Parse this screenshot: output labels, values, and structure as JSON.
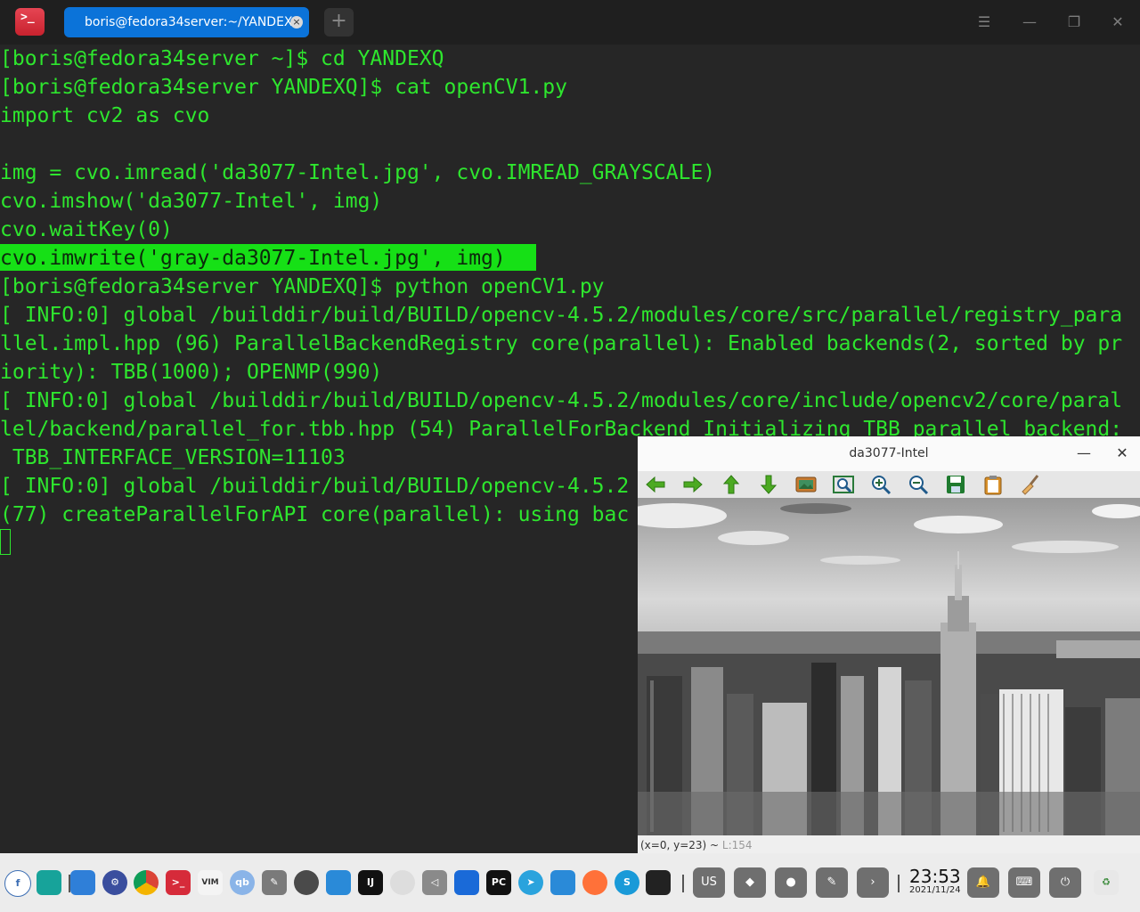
{
  "window": {
    "tab_title": "boris@fedora34server:~/YANDEXQ",
    "tab_close": "×",
    "tab_add": "+",
    "menu_glyph": "☰",
    "minimize_glyph": "—",
    "restore_glyph": "❐",
    "close_glyph": "✕"
  },
  "terminal": {
    "highlight_color": "#16e016",
    "text_color": "#2ee62e",
    "lines": [
      "[boris@fedora34server ~]$ cd YANDEXQ",
      "[boris@fedora34server YANDEXQ]$ cat openCV1.py",
      "import cv2 as cvo",
      "",
      "img = cvo.imread('da3077-Intel.jpg', cvo.IMREAD_GRAYSCALE)",
      "cvo.imshow('da3077-Intel', img)",
      "cvo.waitKey(0)",
      "cvo.imwrite('gray-da3077-Intel.jpg', img)",
      "[boris@fedora34server YANDEXQ]$ python openCV1.py",
      "[ INFO:0] global /builddir/build/BUILD/opencv-4.5.2/modules/core/src/parallel/registry_para",
      "llel.impl.hpp (96) ParallelBackendRegistry core(parallel): Enabled backends(2, sorted by pr",
      "iority): TBB(1000); OPENMP(990)",
      "[ INFO:0] global /builddir/build/BUILD/opencv-4.5.2/modules/core/include/opencv2/core/paral",
      "lel/backend/parallel_for.tbb.hpp (54) ParallelForBackend Initializing TBB parallel backend:",
      " TBB_INTERFACE_VERSION=11103",
      "[ INFO:0] global /builddir/build/BUILD/opencv-4.5.2",
      "(77) createParallelForAPI core(parallel): using bac"
    ]
  },
  "image_window": {
    "title": "da3077-Intel",
    "minimize_glyph": "—",
    "close_glyph": "✕",
    "toolbar": [
      "pan-left-icon",
      "pan-right-icon",
      "pan-up-icon",
      "pan-down-icon",
      "zoom-image-icon",
      "zoom-fit-icon",
      "zoom-in-icon",
      "zoom-out-icon",
      "save-icon",
      "copy-clipboard-icon",
      "properties-brush-icon"
    ],
    "status_coords": "(x=0, y=23) ~",
    "status_value": "L:154"
  },
  "taskbar": {
    "keyboard_layout": "US",
    "time": "23:53",
    "date": "2021/11/24",
    "dock": [
      "fedora-icon",
      "file-manager-icon",
      "appstore-icon",
      "settings-icon",
      "chrome-icon",
      "terminal-icon",
      "vim-icon",
      "qbittorrent-icon",
      "text-editor-icon",
      "gnome-icon",
      "libreoffice-icon",
      "intellij-icon",
      "disk-icon",
      "volume-icon",
      "deepin-icon",
      "pycharm-icon",
      "telegram-icon",
      "system-monitor-icon",
      "firefox-icon",
      "skype-icon",
      "media-player-icon"
    ]
  }
}
